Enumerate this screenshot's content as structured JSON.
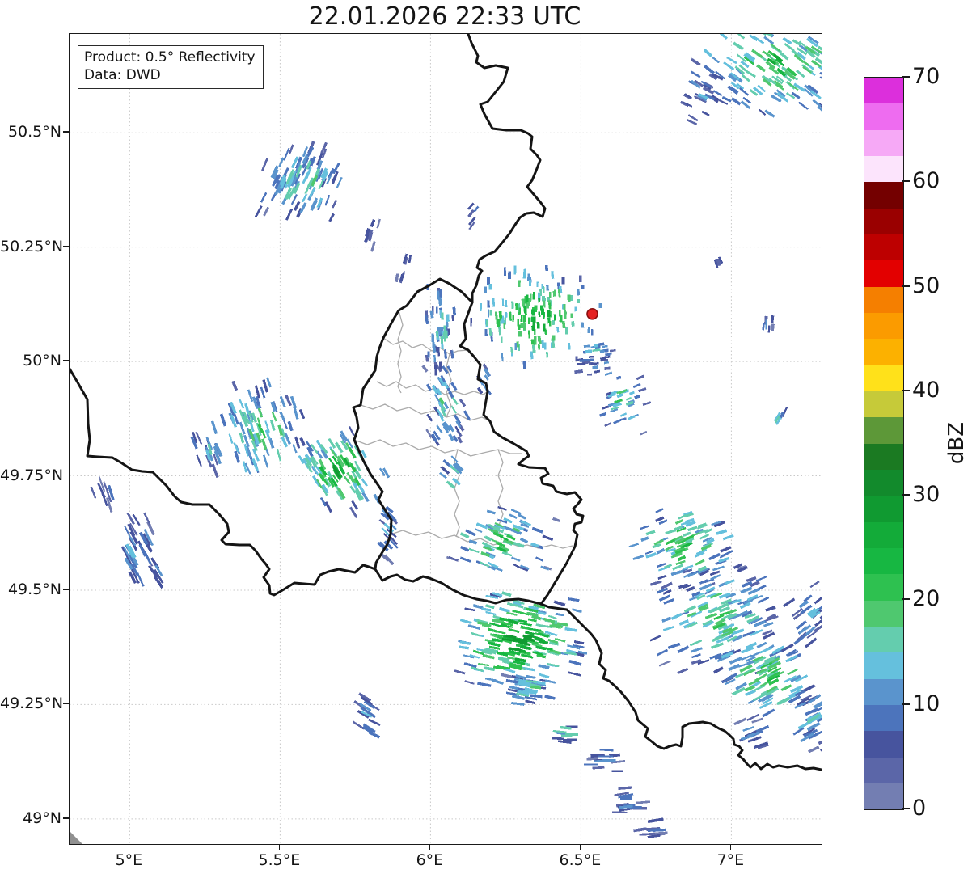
{
  "title": "22.01.2026 22:33 UTC",
  "product_box": {
    "line1": "Product: 0.5° Reflectivity",
    "line2": "Data: DWD"
  },
  "axes": {
    "lat_ticks": [
      {
        "label": "50.5°N",
        "value": 50.5
      },
      {
        "label": "50.25°N",
        "value": 50.25
      },
      {
        "label": "50°N",
        "value": 50.0
      },
      {
        "label": "49.75°N",
        "value": 49.75
      },
      {
        "label": "49.5°N",
        "value": 49.5
      },
      {
        "label": "49.25°N",
        "value": 49.25
      },
      {
        "label": "49°N",
        "value": 49.0
      }
    ],
    "lon_ticks": [
      {
        "label": "5°E",
        "value": 5.0
      },
      {
        "label": "5.5°E",
        "value": 5.5
      },
      {
        "label": "6°E",
        "value": 6.0
      },
      {
        "label": "6.5°E",
        "value": 6.5
      },
      {
        "label": "7°E",
        "value": 7.0
      }
    ],
    "lon_range": [
      4.8,
      7.3
    ],
    "lat_range": [
      48.945,
      50.716
    ]
  },
  "chart_data": {
    "type": "heatmap",
    "title": "22.01.2026 22:33 UTC",
    "colorbar_label": "dBZ",
    "colorbar_ticks": [
      0,
      10,
      20,
      30,
      40,
      50,
      60,
      70
    ],
    "dbz_min": 0,
    "dbz_max": 70,
    "dbz_step": 2.5,
    "palette": [
      "#737eb2",
      "#5b66a8",
      "#47549e",
      "#4c74bc",
      "#5a94cd",
      "#65c0dd",
      "#64cdae",
      "#4fc86f",
      "#2ec150",
      "#17b742",
      "#13ab39",
      "#109a31",
      "#128a2c",
      "#1b7a22",
      "#5d9838",
      "#c6ca39",
      "#ffe11a",
      "#fcb100",
      "#fb9b00",
      "#f57f00",
      "#e30000",
      "#bd0000",
      "#9a0000",
      "#740000",
      "#fce4fc",
      "#f6a9f6",
      "#ee6cf0",
      "#dc2fdc"
    ],
    "marker": {
      "lon": 6.538,
      "lat": 50.104,
      "color": "#e52222",
      "edge_color": "#8a0f0f"
    },
    "clusters": [
      [
        7.15,
        50.655,
        0.48,
        0.21,
        170,
        22
      ],
      [
        6.91,
        50.576,
        0.17,
        0.1,
        26,
        9
      ],
      [
        5.58,
        50.396,
        0.26,
        0.15,
        95,
        16
      ],
      [
        5.8,
        50.276,
        0.05,
        0.07,
        9,
        8
      ],
      [
        5.91,
        50.205,
        0.05,
        0.06,
        7,
        8
      ],
      [
        6.14,
        50.32,
        0.04,
        0.05,
        6,
        8
      ],
      [
        6.035,
        50.072,
        0.1,
        0.17,
        48,
        15
      ],
      [
        6.34,
        50.099,
        0.36,
        0.19,
        160,
        26
      ],
      [
        6.55,
        50.025,
        0.12,
        0.1,
        32,
        13
      ],
      [
        6.64,
        49.913,
        0.14,
        0.12,
        36,
        19
      ],
      [
        6.05,
        49.913,
        0.13,
        0.16,
        48,
        16
      ],
      [
        6.18,
        49.961,
        0.06,
        0.06,
        10,
        10
      ],
      [
        5.43,
        49.852,
        0.3,
        0.19,
        85,
        19
      ],
      [
        5.7,
        49.763,
        0.25,
        0.15,
        90,
        26
      ],
      [
        5.27,
        49.806,
        0.1,
        0.08,
        16,
        12
      ],
      [
        5.02,
        49.587,
        0.12,
        0.15,
        32,
        12
      ],
      [
        4.91,
        49.71,
        0.06,
        0.05,
        9,
        10
      ],
      [
        5.09,
        49.537,
        0.05,
        0.05,
        6,
        12
      ],
      [
        5.86,
        49.639,
        0.06,
        0.13,
        20,
        12
      ],
      [
        6.24,
        49.604,
        0.3,
        0.13,
        75,
        21
      ],
      [
        6.07,
        49.749,
        0.06,
        0.08,
        13,
        19
      ],
      [
        6.29,
        49.392,
        0.37,
        0.19,
        180,
        28
      ],
      [
        6.33,
        49.283,
        0.15,
        0.08,
        30,
        16
      ],
      [
        6.45,
        49.187,
        0.08,
        0.04,
        9,
        19
      ],
      [
        6.58,
        49.127,
        0.1,
        0.05,
        13,
        11
      ],
      [
        6.66,
        49.035,
        0.09,
        0.06,
        15,
        11
      ],
      [
        6.73,
        48.975,
        0.06,
        0.04,
        9,
        10
      ],
      [
        6.84,
        49.595,
        0.28,
        0.16,
        95,
        22
      ],
      [
        6.95,
        49.436,
        0.36,
        0.2,
        130,
        19
      ],
      [
        7.12,
        49.307,
        0.3,
        0.15,
        85,
        22
      ],
      [
        7.26,
        49.445,
        0.12,
        0.12,
        26,
        13
      ],
      [
        7.27,
        49.224,
        0.11,
        0.12,
        26,
        13
      ],
      [
        7.07,
        49.189,
        0.08,
        0.06,
        13,
        10
      ],
      [
        7.12,
        50.085,
        0.04,
        0.04,
        6,
        8
      ],
      [
        7.16,
        49.878,
        0.04,
        0.03,
        5,
        17
      ],
      [
        6.96,
        50.214,
        0.03,
        0.03,
        4,
        6
      ],
      [
        5.79,
        49.224,
        0.06,
        0.08,
        15,
        12
      ]
    ]
  },
  "style": {
    "border_color": "#141414",
    "canton_color": "#ababab",
    "grid_color": "#c9c9c9",
    "background": "#ffffff"
  }
}
